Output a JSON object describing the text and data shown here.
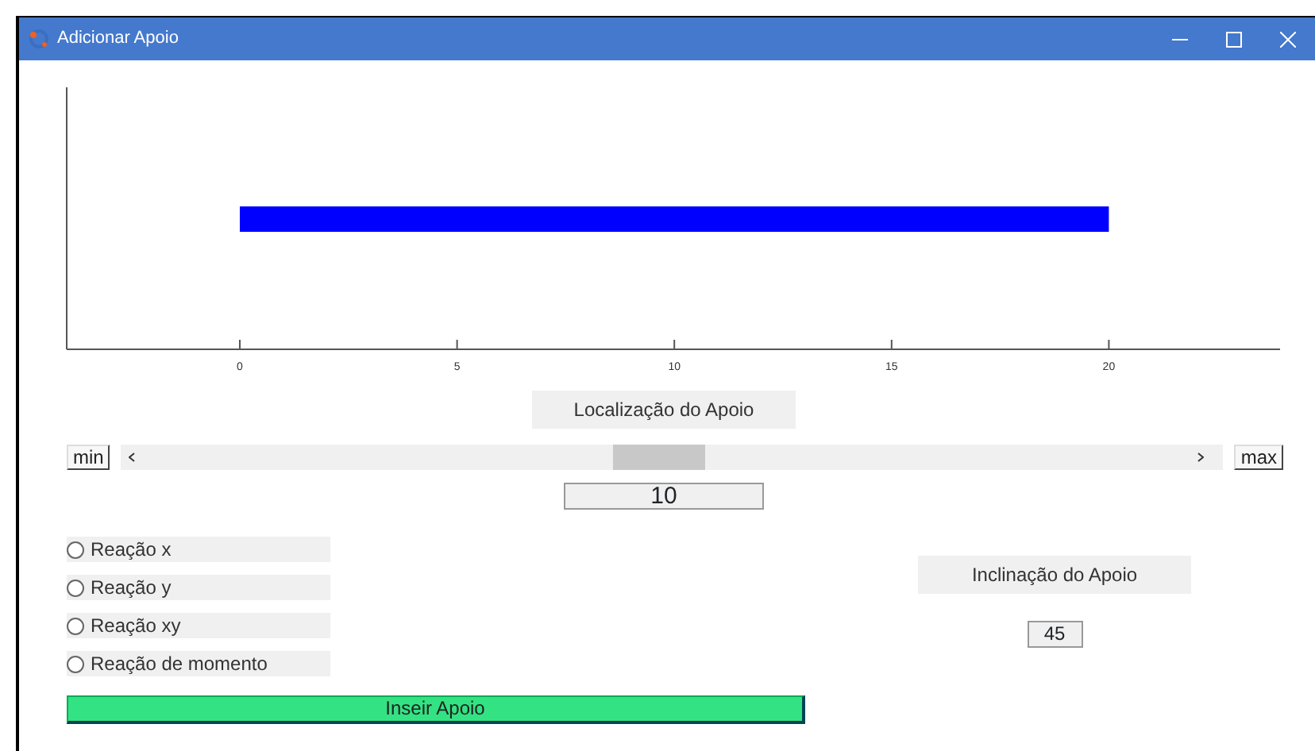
{
  "window": {
    "title": "Adicionar Apoio"
  },
  "beam_plot": {
    "ticks": [
      "0",
      "5",
      "10",
      "15",
      "20"
    ]
  },
  "location": {
    "label": "Localização do Apoio",
    "min_button": "min",
    "max_button": "max",
    "slider": {
      "level": 0.5
    },
    "value": "10"
  },
  "reactions": [
    {
      "label": "Reação x",
      "selected": false
    },
    {
      "label": "Reação y",
      "selected": false
    },
    {
      "label": "Reação xy",
      "selected": false
    },
    {
      "label": "Reação de momento",
      "selected": false
    }
  ],
  "inclination": {
    "label": "Inclinação do Apoio",
    "value": "45"
  },
  "insert_button": "Inseir Apoio"
}
